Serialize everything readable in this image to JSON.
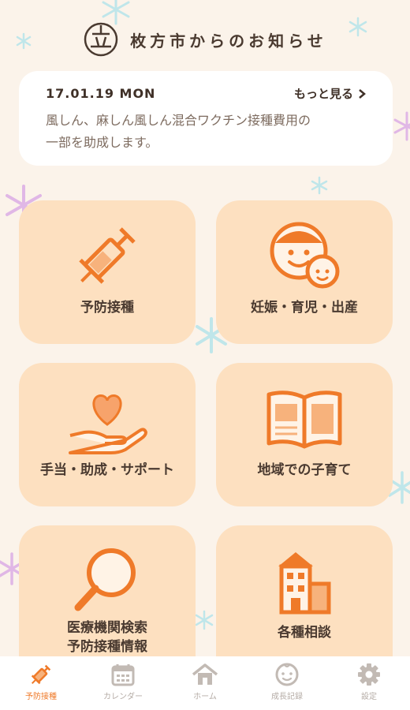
{
  "header": {
    "title": "枚方市からのお知らせ",
    "logo_icon": "hirakata-city-logo"
  },
  "news": {
    "date": "17.01.19 MON",
    "more_label": "もっと見る",
    "text_line1": "風しん、麻しん風しん混合ワクチン接種費用の",
    "text_line2": "一部を助成します。"
  },
  "tiles": [
    {
      "label": "予防接種",
      "icon": "syringe-icon"
    },
    {
      "label": "妊娠・育児・出産",
      "icon": "mother-baby-icon"
    },
    {
      "label": "手当・助成・サポート",
      "icon": "heart-hand-icon"
    },
    {
      "label": "地域での子育て",
      "icon": "open-book-icon"
    },
    {
      "label_line1": "医療機関検索",
      "label_line2": "予防接種情報",
      "icon": "magnifier-icon"
    },
    {
      "label": "各種相談",
      "icon": "building-icon"
    }
  ],
  "tabbar": {
    "active_index": 0,
    "items": [
      {
        "label": "予防接種",
        "icon": "syringe-icon"
      },
      {
        "label": "カレンダー",
        "icon": "calendar-icon"
      },
      {
        "label": "ホーム",
        "icon": "home-icon"
      },
      {
        "label": "成長記録",
        "icon": "baby-face-icon"
      },
      {
        "label": "設定",
        "icon": "gear-icon"
      }
    ]
  },
  "colors": {
    "background": "#fbf3ea",
    "tile": "#fde0c0",
    "accent": "#ef7a29",
    "tab_inactive": "#b5aca6"
  }
}
